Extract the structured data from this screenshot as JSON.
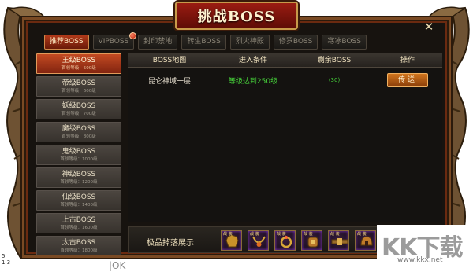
{
  "window": {
    "title": "挑战BOSS",
    "close_glyph": "✕"
  },
  "tabs": [
    {
      "label": "推荐BOSS",
      "active": true
    },
    {
      "label": "VIPBOSS",
      "badge": true
    },
    {
      "label": "封印禁地"
    },
    {
      "label": "转生BOSS"
    },
    {
      "label": "烈火神殿"
    },
    {
      "label": "修罗BOSS"
    },
    {
      "label": "寒冰BOSS"
    }
  ],
  "sidebar": {
    "items": [
      {
        "name": "王级BOSS",
        "req": "首领等级：500级",
        "active": true
      },
      {
        "name": "帝级BOSS",
        "req": "首领等级：600级"
      },
      {
        "name": "妖级BOSS",
        "req": "首领等级：700级"
      },
      {
        "name": "魔级BOSS",
        "req": "首领等级：800级"
      },
      {
        "name": "鬼级BOSS",
        "req": "首领等级：1000级"
      },
      {
        "name": "神级BOSS",
        "req": "首领等级：1200级"
      },
      {
        "name": "仙级BOSS",
        "req": "首领等级：1400级"
      },
      {
        "name": "上古BOSS",
        "req": "首领等级：1600级"
      },
      {
        "name": "太古BOSS",
        "req": "首领等级：1800级"
      }
    ]
  },
  "table": {
    "headers": {
      "map": "BOSS地图",
      "condition": "进入条件",
      "remaining": "剩余BOSS",
      "action": "操作"
    },
    "rows": [
      {
        "map": "昆仑神域一层",
        "condition": "等级达到250级",
        "remaining": "(30)",
        "action": "传送"
      }
    ]
  },
  "drops": {
    "label": "极品掉落展示",
    "items": [
      {
        "tag": "战\n装",
        "icon": "armor-icon"
      },
      {
        "tag": "战\n装",
        "icon": "necklace-icon"
      },
      {
        "tag": "战\n装",
        "icon": "ring-icon"
      },
      {
        "tag": "战\n装",
        "icon": "bracelet-icon"
      },
      {
        "tag": "战\n装",
        "icon": "belt-icon"
      },
      {
        "tag": "战\n装",
        "icon": "helmet-icon"
      }
    ]
  },
  "watermark": {
    "logo": "KK下载",
    "url": "www.kkx.net"
  },
  "overlay": {
    "corner_line1": "5",
    "corner_line2": "1 3",
    "ok_text": "|OK"
  },
  "colors": {
    "accent": "#b03a1a",
    "green_text": "#46d23a",
    "frame": "#7a4a24"
  }
}
